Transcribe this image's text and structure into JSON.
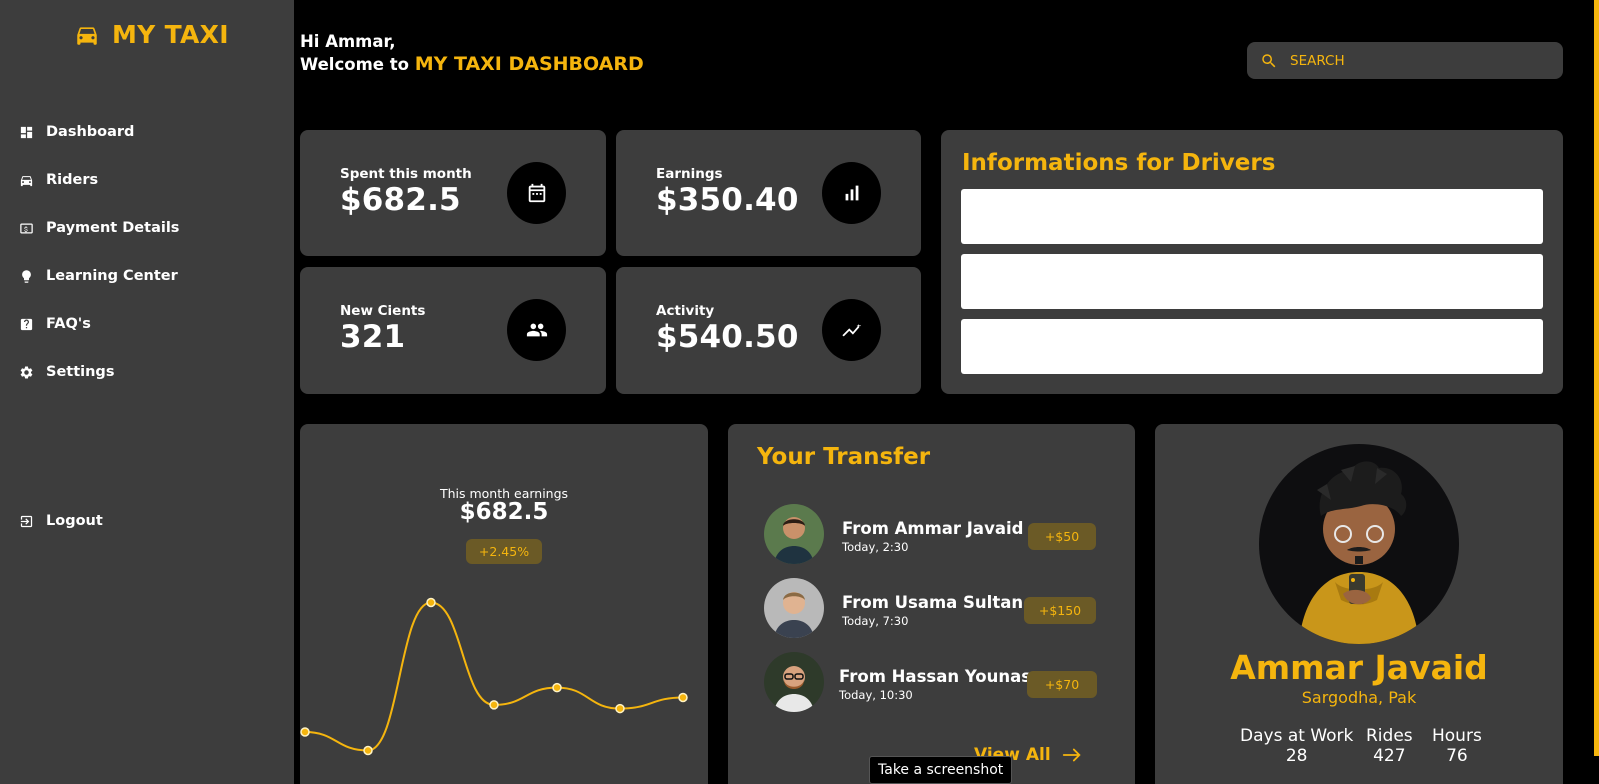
{
  "app": {
    "brand": "MY TAXI"
  },
  "sidebar": {
    "items": [
      {
        "label": "Dashboard",
        "icon": "dashboard-icon"
      },
      {
        "label": "Riders",
        "icon": "car-icon"
      },
      {
        "label": "Payment Details",
        "icon": "payment-icon"
      },
      {
        "label": "Learning Center",
        "icon": "lightbulb-icon"
      },
      {
        "label": "FAQ's",
        "icon": "help-icon"
      },
      {
        "label": "Settings",
        "icon": "gear-icon"
      }
    ],
    "logout": {
      "label": "Logout",
      "icon": "logout-icon"
    }
  },
  "header": {
    "greeting": "Hi Ammar,",
    "welcome": "Welcome to",
    "dashboard_name": "MY TAXI DASHBOARD",
    "search_placeholder": "SEARCH"
  },
  "stats": [
    {
      "label": "Spent this month",
      "value": "$682.5",
      "icon": "calendar-icon"
    },
    {
      "label": "Earnings",
      "value": "$350.40",
      "icon": "bar-chart-icon"
    },
    {
      "label": "New Cients",
      "value": "321",
      "icon": "people-icon"
    },
    {
      "label": "Activity",
      "value": "$540.50",
      "icon": "trending-icon"
    }
  ],
  "info": {
    "title": "Informations for Drivers"
  },
  "earnings": {
    "label": "This month earnings",
    "value": "$682.5",
    "change": "+2.45%"
  },
  "chart_data": {
    "type": "line",
    "x": [
      1,
      2,
      3,
      4,
      5,
      6,
      7
    ],
    "values": [
      30,
      15,
      135,
      52,
      66,
      49,
      58
    ],
    "ylim": [
      0,
      150
    ],
    "grid": false,
    "color": "#f5b50e"
  },
  "transfers": {
    "title": "Your Transfer",
    "items": [
      {
        "name": "From Ammar Javaid",
        "time": "Today, 2:30",
        "amount": "+$50"
      },
      {
        "name": "From Usama Sultan",
        "time": "Today, 7:30",
        "amount": "+$150"
      },
      {
        "name": "From Hassan Younas",
        "time": "Today, 10:30",
        "amount": "+$70"
      }
    ],
    "view_all": "View All"
  },
  "profile": {
    "name": "Ammar Javaid",
    "location": "Sargodha, Pak",
    "stats": [
      {
        "label": "Days at Work",
        "value": "28"
      },
      {
        "label": "Rides",
        "value": "427"
      },
      {
        "label": "Hours",
        "value": "76"
      }
    ]
  },
  "tooltip": "Take a screenshot",
  "colors": {
    "accent": "#f5b50e",
    "panel": "#3d3d3d",
    "background": "#000000"
  }
}
